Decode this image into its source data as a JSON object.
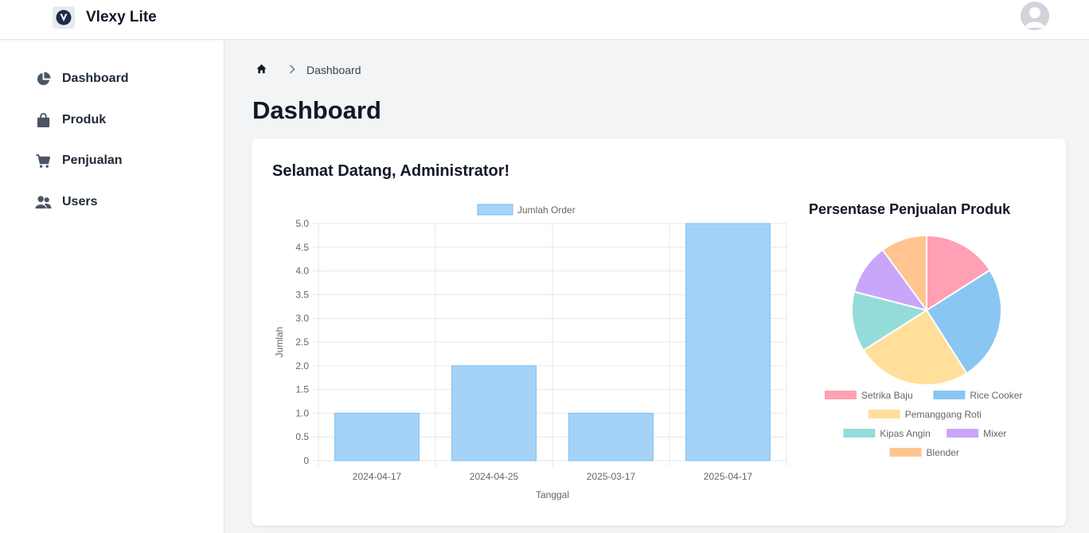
{
  "app": {
    "name": "Vlexy Lite"
  },
  "sidebar": {
    "items": [
      {
        "label": "Dashboard",
        "icon": "chart-pie-icon"
      },
      {
        "label": "Produk",
        "icon": "shopping-bag-icon"
      },
      {
        "label": "Penjualan",
        "icon": "shopping-cart-icon"
      },
      {
        "label": "Users",
        "icon": "users-icon"
      }
    ]
  },
  "breadcrumb": {
    "current": "Dashboard"
  },
  "page": {
    "title": "Dashboard",
    "welcome": "Selamat Datang, Administrator!"
  },
  "colors": {
    "bar_fill": "#a5d3f7",
    "bar_border": "#7cbdf0",
    "grid": "#e5e7eb",
    "text_dark": "#111827"
  },
  "chart_data": [
    {
      "type": "bar",
      "categories": [
        "2024-04-17",
        "2024-04-25",
        "2025-03-17",
        "2025-04-17"
      ],
      "series": [
        {
          "name": "Jumlah Order",
          "values": [
            1,
            2,
            1,
            5
          ]
        }
      ],
      "xlabel": "Tanggal",
      "ylabel": "Jumlah",
      "ylim": [
        0,
        5
      ],
      "yticks": [
        "0",
        "0.5",
        "1.0",
        "1.5",
        "2.0",
        "2.5",
        "3.0",
        "3.5",
        "4.0",
        "4.5",
        "5.0"
      ],
      "grid": true,
      "legend": "top"
    },
    {
      "type": "pie",
      "title": "Persentase Penjualan Produk",
      "slices": [
        {
          "label": "Setrika Baju",
          "value": 16,
          "color": "#ffa0b4"
        },
        {
          "label": "Rice Cooker",
          "value": 25,
          "color": "#8ac6f2"
        },
        {
          "label": "Pemanggang Roti",
          "value": 25,
          "color": "#ffdf99"
        },
        {
          "label": "Kipas Angin",
          "value": 13,
          "color": "#94dcd9"
        },
        {
          "label": "Mixer",
          "value": 11,
          "color": "#c9a6fa"
        },
        {
          "label": "Blender",
          "value": 10,
          "color": "#ffc490"
        }
      ],
      "legend": "bottom"
    }
  ]
}
